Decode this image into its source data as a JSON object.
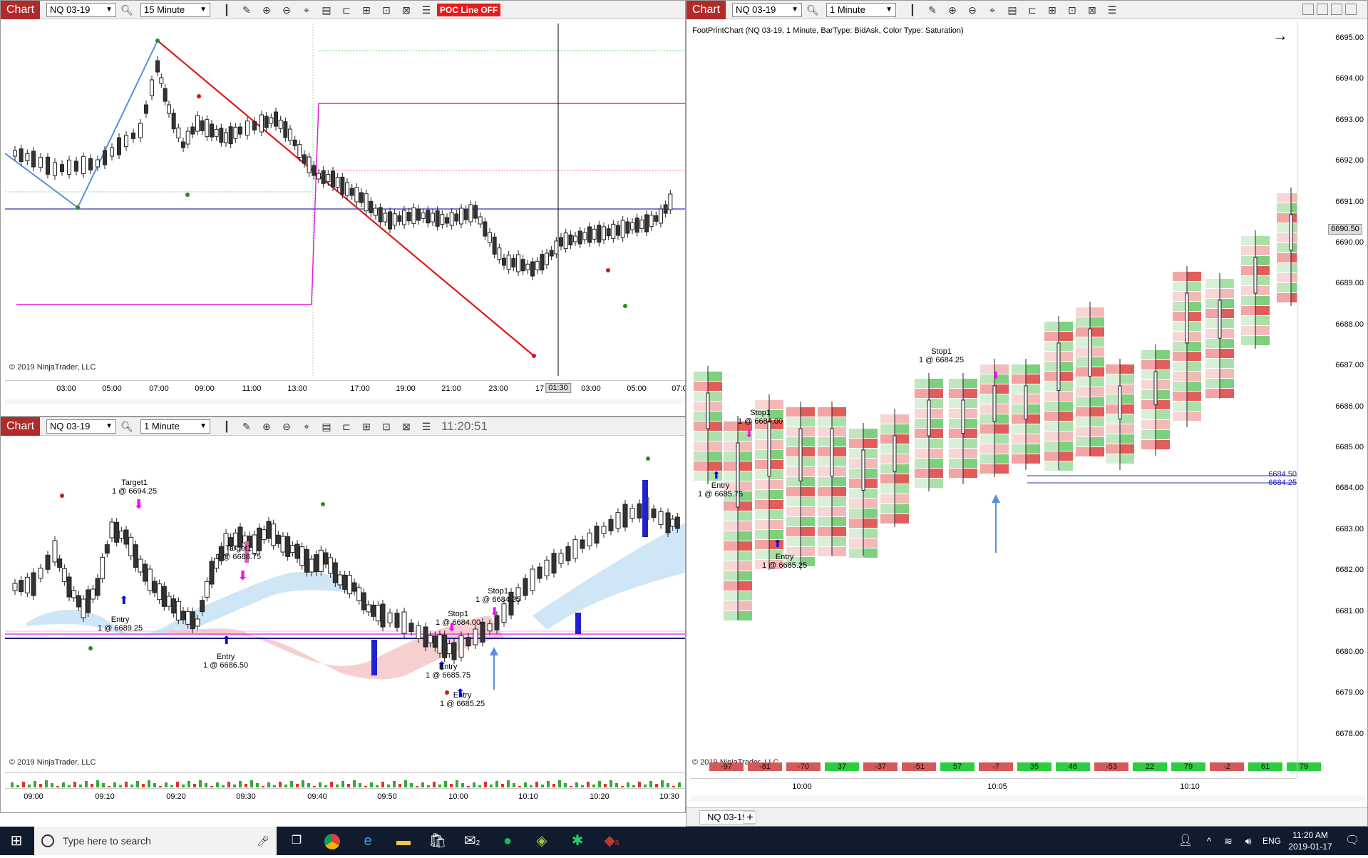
{
  "top_left": {
    "tag": "Chart",
    "instrument": "NQ 03-19",
    "interval": "15 Minute",
    "poc_button": "POC Line OFF",
    "copyright": "© 2019 NinjaTrader, LLC",
    "x_ticks": [
      "03:00",
      "05:00",
      "07:00",
      "09:00",
      "11:00",
      "13:00",
      "17:00",
      "19:00",
      "21:00",
      "23:00",
      "17",
      "01:30",
      "03:00",
      "05:00",
      "07:0"
    ]
  },
  "bottom_left": {
    "tag": "Chart",
    "instrument": "NQ 03-19",
    "interval": "1 Minute",
    "clock": "11:20:51",
    "copyright": "© 2019 NinjaTrader, LLC",
    "x_ticks": [
      "09:00",
      "09:10",
      "09:20",
      "09:30",
      "09:40",
      "09:50",
      "10:00",
      "10:10",
      "10:20",
      "10:30"
    ],
    "annotations": [
      {
        "title": "Target1",
        "detail": "1 @ 6694.25"
      },
      {
        "title": "Target1",
        "detail": "1 @ 6688.75"
      },
      {
        "title": "Entry",
        "detail": "1 @ 6689.25"
      },
      {
        "title": "Entry",
        "detail": "1 @ 6686.50"
      },
      {
        "title": "Stop1",
        "detail": "1 @ 6684.00"
      },
      {
        "title": "Stop1",
        "detail": "1 @ 6684.25"
      },
      {
        "title": "Entry",
        "detail": "1 @ 6685.75"
      },
      {
        "title": "Entry",
        "detail": "1 @ 6685.25"
      }
    ]
  },
  "right": {
    "tag": "Chart",
    "instrument": "NQ 03-19",
    "interval": "1 Minute",
    "header": "FootPrintChart (NQ 03-19, 1 Minute, BarType: BidAsk, Color Type: Saturation)",
    "copyright": "© 2019 NinjaTrader, LLC",
    "tab": "NQ 03-19",
    "add_tab": "+",
    "y_ticks": [
      "6695.00",
      "6694.00",
      "6693.00",
      "6692.00",
      "6691.00",
      "6690.00",
      "6689.00",
      "6688.00",
      "6687.00",
      "6686.00",
      "6685.00",
      "6684.00",
      "6683.00",
      "6682.00",
      "6681.00",
      "6680.00",
      "6679.00",
      "6678.00"
    ],
    "price_marker": "6690.50",
    "levels": [
      "6684.50",
      "6684.25"
    ],
    "x_ticks": [
      "10:00",
      "10:05",
      "10:10"
    ],
    "deltas": [
      "-97",
      "-81",
      "-70",
      "37",
      "-37",
      "-51",
      "57",
      "-7",
      "35",
      "46",
      "-53",
      "22",
      "79",
      "-2",
      "61",
      "79"
    ],
    "annotations": [
      {
        "title": "Stop1",
        "detail": "1 @ 6684.00"
      },
      {
        "title": "Entry",
        "detail": "1 @ 6685.75"
      },
      {
        "title": "Entry",
        "detail": "1 @ 6685.25"
      },
      {
        "title": "Stop1",
        "detail": "1 @ 6684.25"
      }
    ]
  },
  "taskbar": {
    "search_placeholder": "Type here to search",
    "language": "ENG",
    "time": "11:20 AM",
    "date": "2019-01-17",
    "mail_badge": "2",
    "app_badge": "8"
  }
}
